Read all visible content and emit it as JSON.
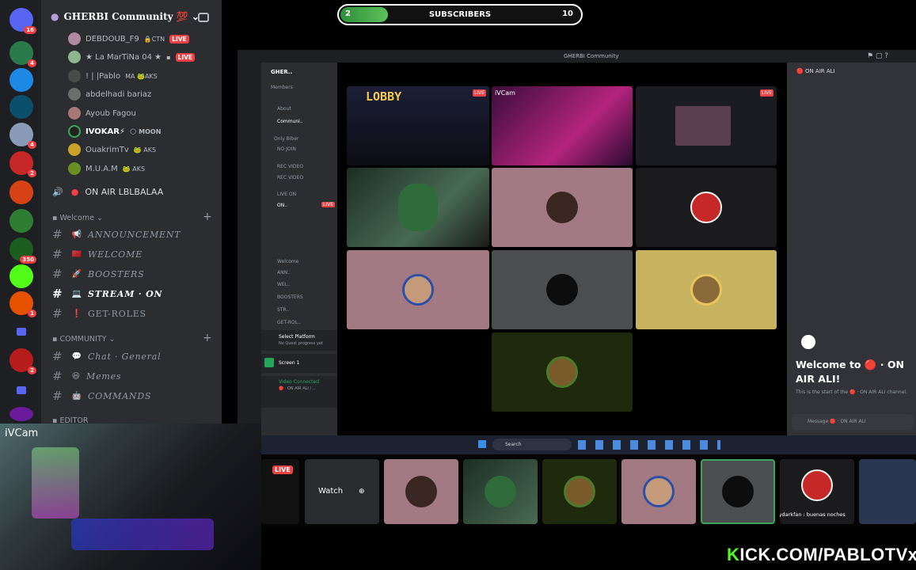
{
  "score": {
    "left": "2",
    "label": "SUBSCRIBERS",
    "right": "10",
    "progress": 0.2
  },
  "rail": {
    "badges": [
      "16",
      "4",
      "4",
      "2",
      "350",
      "1",
      "2"
    ]
  },
  "guild": {
    "name": "GHERBI Community 💯",
    "chevron": "⌄"
  },
  "voice_users": [
    {
      "name": "DEBDOUB_F9",
      "tag": "🔒CTN",
      "live": "LIVE"
    },
    {
      "name": "★ La MarTiNa 04 ★",
      "tag": "",
      "live": "LIVE"
    },
    {
      "name": "! | |Pablo",
      "tag": "MA 🐸AKS",
      "live": ""
    },
    {
      "name": "abdelhadi bariaz",
      "tag": "",
      "live": ""
    },
    {
      "name": "Ayoub Fagou",
      "tag": "",
      "live": ""
    },
    {
      "name": "IVOKAR⚡",
      "tag": "🌕 MOON",
      "live": ""
    },
    {
      "name": "OuakrimTv",
      "tag": "🐸 AKS",
      "live": ""
    },
    {
      "name": "M.U.A.M",
      "tag": "🐸 AKS",
      "live": ""
    }
  ],
  "on_air": "ON AIR LBLBALAA",
  "welcome_cat": "Welcome",
  "community_cat": "COMMUNITY",
  "editor_cat": "EDITOR",
  "channels_welcome": [
    {
      "emoji": "📢",
      "name": "ANNOUNCEMENT",
      "badge": ""
    },
    {
      "emoji": "🇲🇦",
      "name": "WELCOME",
      "badge": ""
    },
    {
      "emoji": "🚀",
      "name": "BOOSTERS",
      "badge": ""
    },
    {
      "emoji": "💻",
      "name": "STREAM · ON",
      "badge": "2"
    },
    {
      "emoji": "❗",
      "name": "GET-ROLES",
      "badge": ""
    }
  ],
  "channels_community": [
    {
      "emoji": "💬",
      "name": "Chat · General"
    },
    {
      "emoji": "😆",
      "name": "Memes"
    },
    {
      "emoji": "🤖",
      "name": "COMMANDS"
    }
  ],
  "inner": {
    "title": "GHERBI Community",
    "guild": "GHER..",
    "members": "Members",
    "lobby": "LOBBY",
    "ivcam": "iVCam",
    "live": "LIVE",
    "chat_header": "ON AIR ALI",
    "welcome_title": "Welcome to 🔴 · ON AIR ALI!",
    "welcome_sub": "This is the start of the 🔴 · ON AIR ALI channel.",
    "msg_placeholder": "Message 🔴 · ON AIR ALI",
    "select_platform": "Select Platform",
    "select_sub": "No Quest progress yet",
    "screen": "Screen 1",
    "video_conn": "Video Connected",
    "video_sub": "🔴 · ON AIR ALI / ..",
    "small_channels": [
      "About",
      "Communi..",
      "Only Biber",
      "NO JOIN",
      "REC VIDEO",
      "REC VIDEO",
      "LIVE ON",
      "ON..",
      "Welcome",
      "ANN..",
      "WEL..",
      "BOOSTERS",
      "STR..",
      "GET-ROL.."
    ]
  },
  "taskbar": {
    "search": "Search"
  },
  "strip": {
    "live": "LIVE",
    "watch": "Watch",
    "caption": "rydarkfan : buenas noches"
  },
  "cam": {
    "label": "iVCam"
  },
  "kick": {
    "k": "K",
    "rest": "ICK.COM/PABLOTVx"
  }
}
